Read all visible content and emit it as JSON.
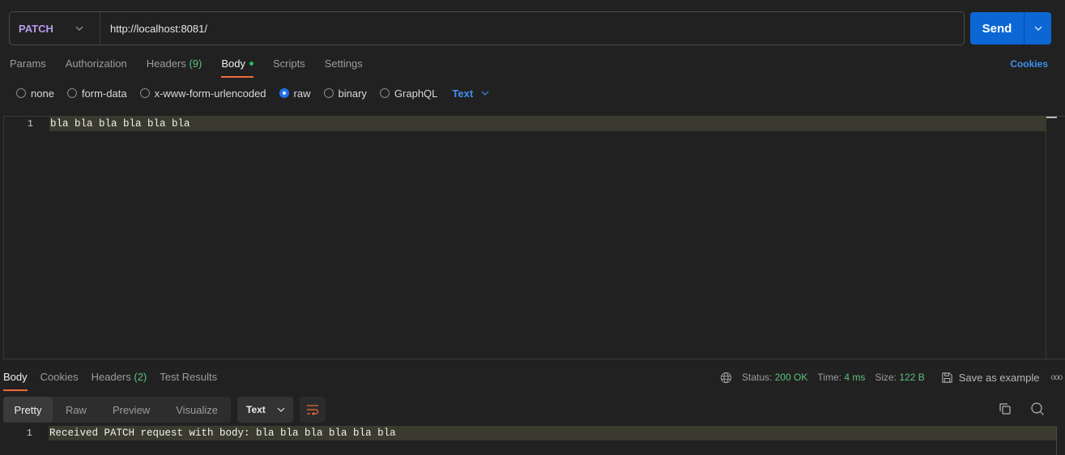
{
  "request": {
    "method": "PATCH",
    "url": "http://localhost:8081/",
    "send_label": "Send"
  },
  "request_tabs": [
    {
      "label": "Params"
    },
    {
      "label": "Authorization"
    },
    {
      "label": "Headers",
      "count": "(9)"
    },
    {
      "label": "Body",
      "active": true,
      "indicator": "green-dot"
    },
    {
      "label": "Scripts"
    },
    {
      "label": "Settings"
    }
  ],
  "cookies_link": "Cookies",
  "body_types": [
    {
      "label": "none",
      "checked": false
    },
    {
      "label": "form-data",
      "checked": false
    },
    {
      "label": "x-www-form-urlencoded",
      "checked": false
    },
    {
      "label": "raw",
      "checked": true
    },
    {
      "label": "binary",
      "checked": false
    },
    {
      "label": "GraphQL",
      "checked": false
    }
  ],
  "raw_type": "Text",
  "editor": {
    "lines": [
      {
        "num": "1",
        "text": "bla bla bla bla bla bla"
      }
    ]
  },
  "response_tabs": [
    {
      "label": "Body",
      "active": true
    },
    {
      "label": "Cookies"
    },
    {
      "label": "Headers",
      "count": "(2)"
    },
    {
      "label": "Test Results"
    }
  ],
  "response_status": {
    "status_label": "Status:",
    "status_value": "200 OK",
    "time_label": "Time:",
    "time_value": "4 ms",
    "size_label": "Size:",
    "size_value": "122 B",
    "save_example_label": "Save as example",
    "more_label": "ooo"
  },
  "response_view_modes": [
    {
      "label": "Pretty",
      "active": true
    },
    {
      "label": "Raw"
    },
    {
      "label": "Preview"
    },
    {
      "label": "Visualize"
    }
  ],
  "response_format": "Text",
  "response_body": {
    "lines": [
      {
        "num": "1",
        "text": "Received PATCH request with body: bla bla bla bla bla bla"
      }
    ]
  },
  "colors": {
    "accent_blue": "#0c67d4",
    "link_blue": "#3f8ff0",
    "method_purple": "#b79ced",
    "success_green": "#5bc17d",
    "active_tab_underline": "#f26b3a"
  }
}
